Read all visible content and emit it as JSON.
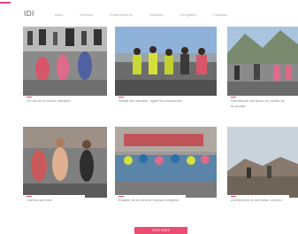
{
  "header": {
    "logo": "IDI",
    "nav": [
      "Inicio",
      "Eventos",
      "Entrenamiento",
      "Nutrición",
      "Fotografía",
      "Contacto"
    ]
  },
  "articles": [
    {
      "caption": "Un día en la sierra, maratón"
    },
    {
      "caption": "Salida del maratón, sigue las emociones"
    },
    {
      "caption": "Voluntarios corriendo en medio de la ciudad"
    },
    {
      "caption": "Carrera del mes"
    },
    {
      "caption": "Estadio de la carrera, equipo completo"
    },
    {
      "caption": "Aventura en la montaña, camino"
    }
  ],
  "load_more": {
    "label": "VER MÁS"
  },
  "colors": {
    "accent": "#e9467a"
  }
}
